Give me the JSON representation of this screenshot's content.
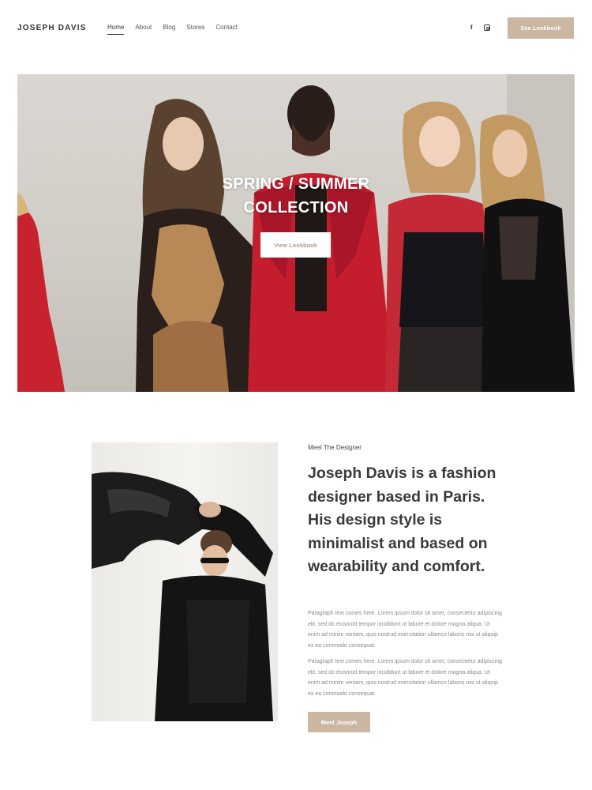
{
  "brand": {
    "name": "JOSEPH DAVIS"
  },
  "nav": {
    "items": [
      {
        "label": "Home",
        "active": true
      },
      {
        "label": "About",
        "active": false
      },
      {
        "label": "Blog",
        "active": false
      },
      {
        "label": "Stores",
        "active": false
      },
      {
        "label": "Contact",
        "active": false
      }
    ]
  },
  "social": {
    "facebook_icon": "f",
    "instagram_icon": "instagram-icon"
  },
  "header_cta": {
    "label": "See Lookbook"
  },
  "hero": {
    "title_line1": "SPRING / SUMMER",
    "title_line2": "COLLECTION",
    "button_label": "View Lookbook"
  },
  "designer": {
    "eyebrow": "Meet The Designer",
    "headline": "Joseph Davis is a fashion designer based in Paris. His design style is minimalist and based on wearability and comfort.",
    "paragraph1": "Paragraph text comes here. Lorem ipsum dolor sit amet, consectetur adipiscing elit, sed do eiusmod tempor incididunt ut labore et dolore magna aliqua. Ut enim ad minim veniam, quis nostrud exercitation ullamco laboris nisi ut aliquip ex ea commodo consequat.",
    "paragraph2": "Paragraph text comes here. Lorem ipsum dolor sit amet, consectetur adipiscing elit, sed do eiusmod tempor incididunt ut labore et dolore magna aliqua. Ut enim ad minim veniam, quis nostrud exercitation ullamco laboris nisi ut aliquip ex ea commodo consequat.",
    "button_label": "Meet Joseph"
  },
  "colors": {
    "accent": "#cbb6a1",
    "text_dark": "#3a3a3a",
    "text_muted": "#8a8a8a"
  }
}
